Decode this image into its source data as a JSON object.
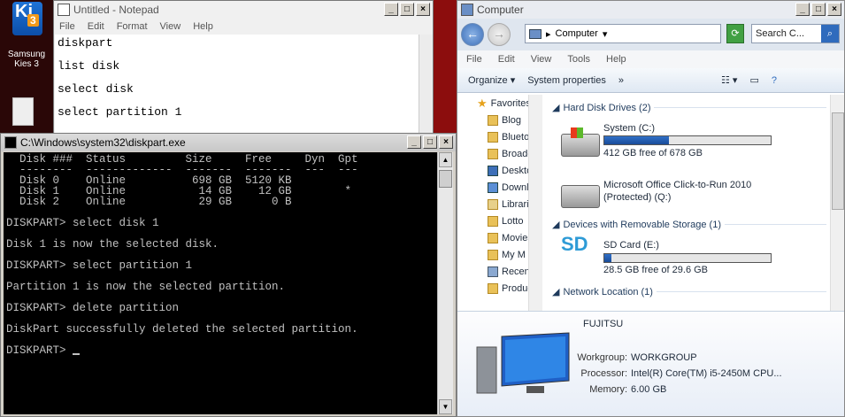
{
  "desktop": {
    "kies_label": "Samsung Kies 3",
    "kies_k": "Ki",
    "kies_num": "3"
  },
  "notepad": {
    "title": "Untitled - Notepad",
    "menu": [
      "File",
      "Edit",
      "Format",
      "View",
      "Help"
    ],
    "lines": [
      "diskpart",
      "list disk",
      "select disk",
      "select partition 1"
    ]
  },
  "cmd": {
    "title": "C:\\Windows\\system32\\diskpart.exe",
    "lines": [
      "  Disk ###  Status         Size     Free     Dyn  Gpt",
      "  --------  -------------  -------  -------  ---  ---",
      "  Disk 0    Online          698 GB  5120 KB",
      "  Disk 1    Online           14 GB    12 GB        *",
      "  Disk 2    Online           29 GB      0 B",
      "",
      "DISKPART> select disk 1",
      "",
      "Disk 1 is now the selected disk.",
      "",
      "DISKPART> select partition 1",
      "",
      "Partition 1 is now the selected partition.",
      "",
      "DISKPART> delete partition",
      "",
      "DiskPart successfully deleted the selected partition.",
      "",
      "DISKPART> "
    ]
  },
  "explorer": {
    "title": "Computer",
    "address": "Computer",
    "search_placeholder": "Search C...",
    "menu": [
      "File",
      "Edit",
      "View",
      "Tools",
      "Help"
    ],
    "toolbar": {
      "organize": "Organize",
      "sysprops": "System properties",
      "more": "»"
    },
    "nav": {
      "favorites": "Favorites",
      "items": [
        "Blog",
        "Bluetooth",
        "Broadcasts",
        "Desktop",
        "Downloads",
        "Libraries",
        "Lotto",
        "Movies",
        "My M",
        "Recent",
        "Products"
      ]
    },
    "groups": {
      "hdd": "Hard Disk Drives (2)",
      "removable": "Devices with Removable Storage (1)",
      "network": "Network Location (1)"
    },
    "drives": {
      "c_name": "System (C:)",
      "c_free": "412 GB free of 678 GB",
      "c_used_fraction": 0.39,
      "q_name1": "Microsoft Office Click-to-Run 2010",
      "q_name2": "(Protected) (Q:)",
      "e_name": "SD Card (E:)",
      "e_free": "28.5 GB free of 29.6 GB",
      "e_used_fraction": 0.04
    },
    "details": {
      "maker": "FUJITSU",
      "workgroup_label": "Workgroup:",
      "workgroup": "WORKGROUP",
      "processor_label": "Processor:",
      "processor": "Intel(R) Core(TM) i5-2450M CPU...",
      "memory_label": "Memory:",
      "memory": "6.00 GB"
    }
  }
}
